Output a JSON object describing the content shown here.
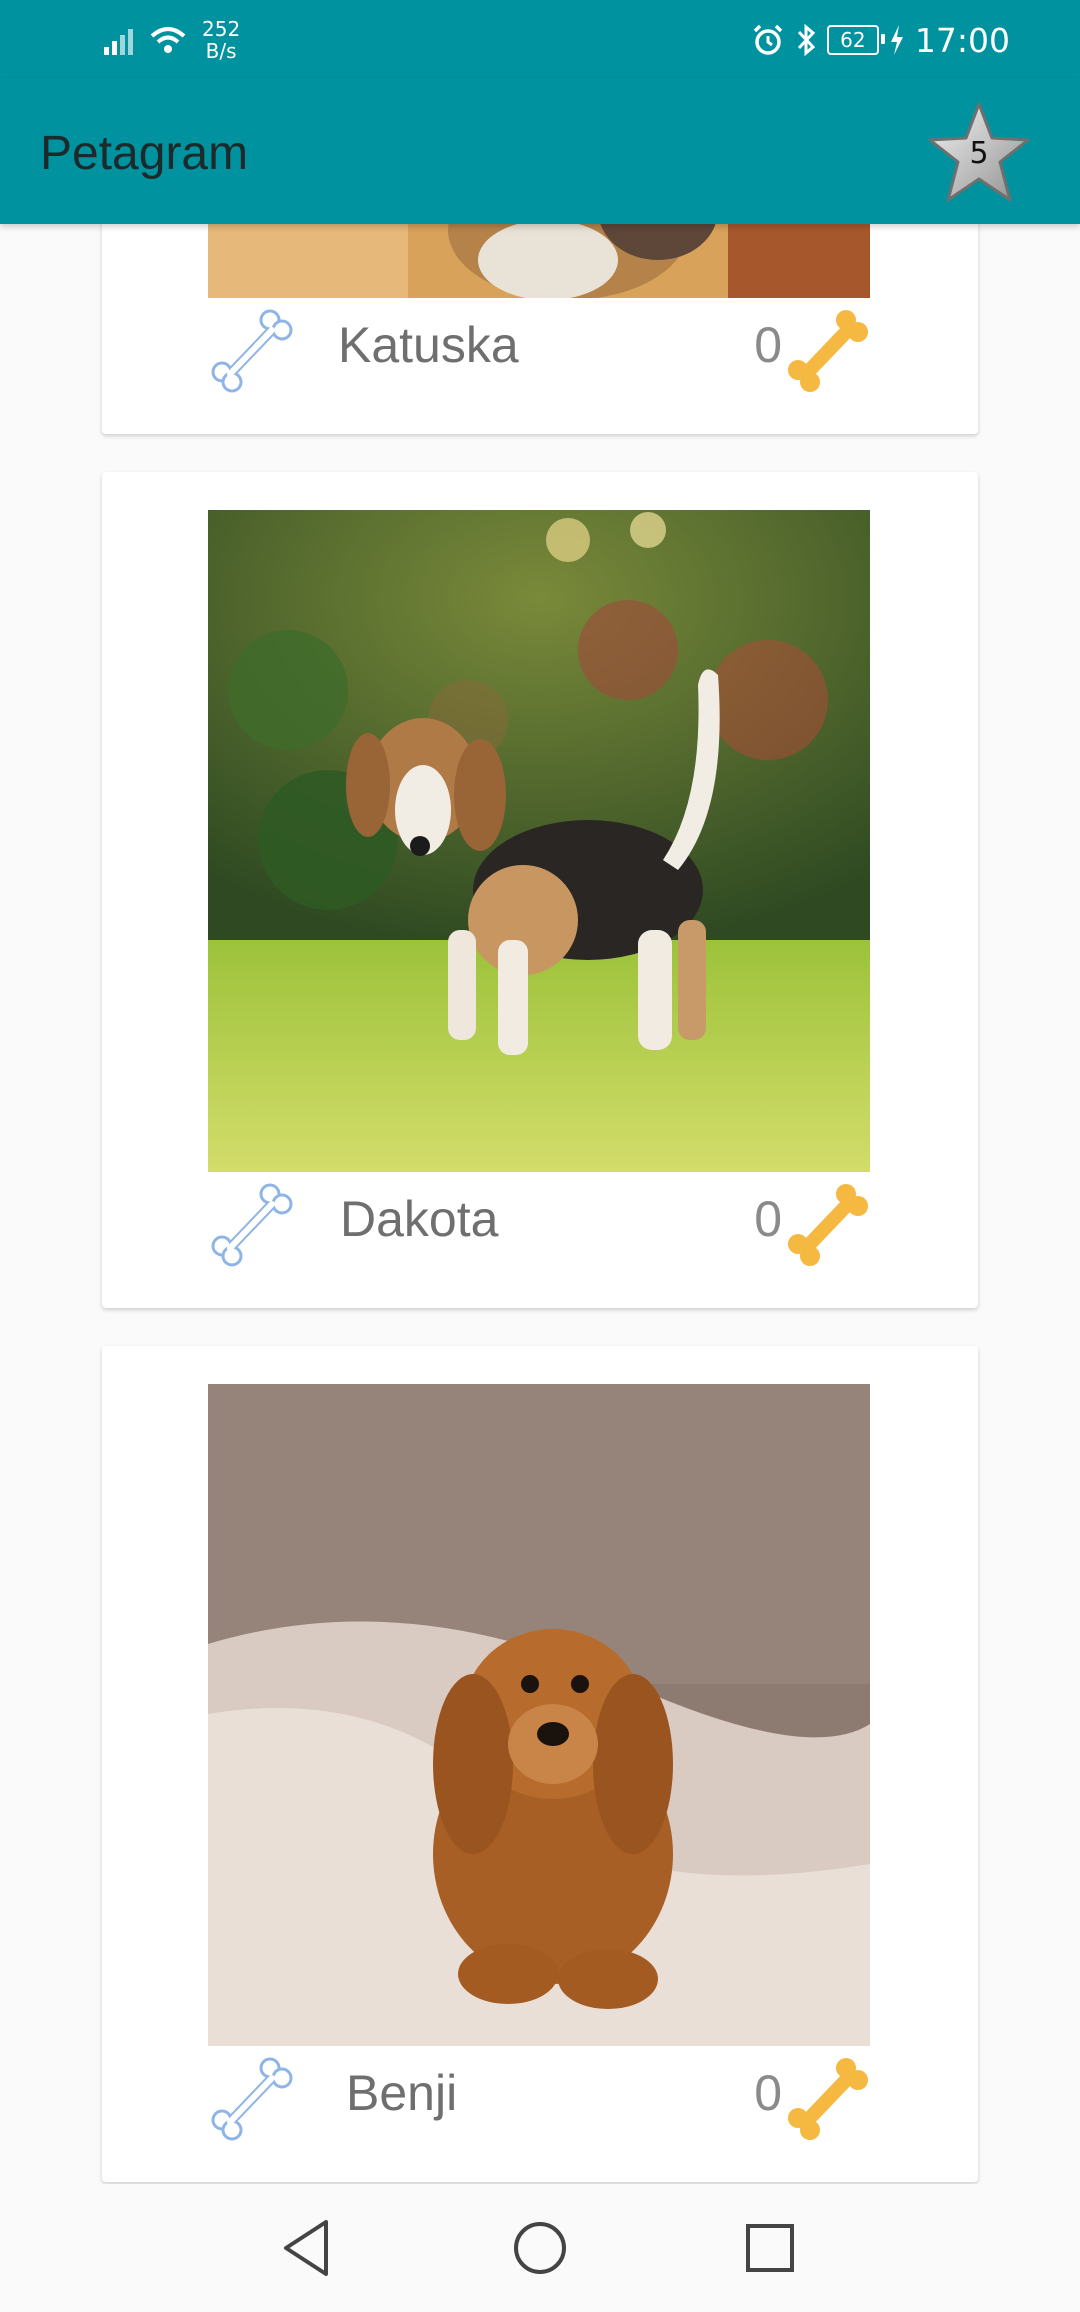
{
  "status_bar": {
    "net_speed_value": "252",
    "net_speed_unit": "B/s",
    "battery": "62",
    "time": "17:00"
  },
  "toolbar": {
    "title": "Petagram",
    "favorites_count": "5"
  },
  "pets": [
    {
      "name": "Katuska",
      "likes": "0"
    },
    {
      "name": "Dakota",
      "likes": "0"
    },
    {
      "name": "Benji",
      "likes": "0"
    }
  ],
  "colors": {
    "primary": "#00939f",
    "bone_outline": "#8fb4e6",
    "bone_gold": "#f5b941"
  },
  "icons": {
    "favorites": "star-icon",
    "like": "bone-outline-icon",
    "likes_count": "bone-gold-icon",
    "nav": [
      "back-icon",
      "home-icon",
      "recents-icon"
    ]
  }
}
